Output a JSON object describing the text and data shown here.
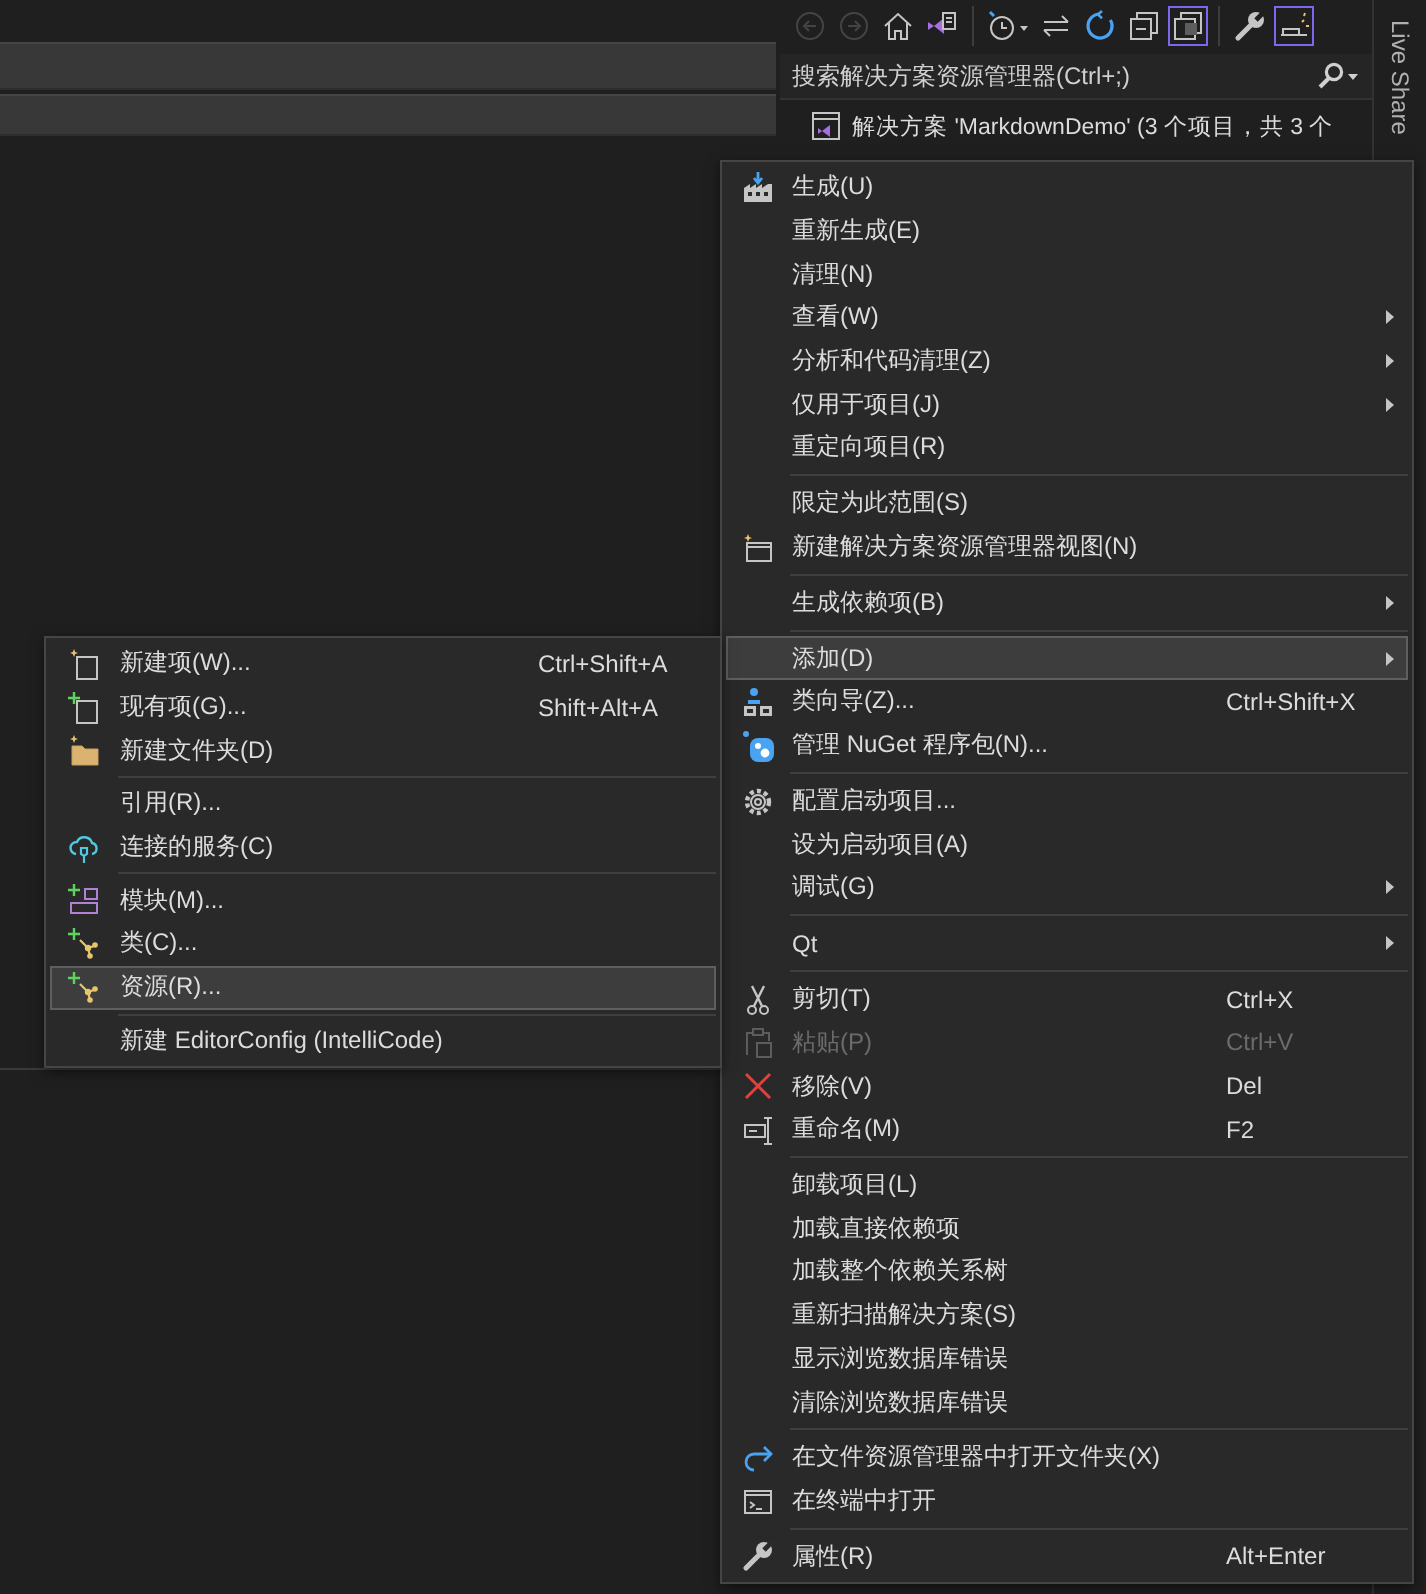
{
  "toolbar": {
    "buttons": [
      {
        "disabled": true,
        "on": false
      },
      {
        "disabled": true,
        "on": false
      },
      {
        "disabled": false,
        "on": false
      },
      {
        "disabled": false,
        "on": false
      },
      {
        "disabled": false,
        "on": false
      },
      {
        "disabled": false,
        "on": false
      },
      {
        "disabled": false,
        "on": false
      },
      {
        "disabled": false,
        "on": false
      },
      {
        "disabled": false,
        "on": true
      },
      {
        "disabled": false,
        "on": false
      },
      {
        "disabled": false,
        "on": true
      }
    ]
  },
  "search": {
    "placeholder": "搜索解决方案资源管理器(Ctrl+;)"
  },
  "tree": {
    "items": [
      {
        "label": "解决方案 'MarkdownDemo' (3 个项目，共 3 个"
      }
    ]
  },
  "side_tab": {
    "label": "Live Share"
  },
  "context_menu": {
    "items": [
      {
        "kind": "item",
        "label": "生成(U)",
        "submenu": false,
        "disabled": false,
        "selected": false
      },
      {
        "kind": "item",
        "label": "重新生成(E)",
        "submenu": false,
        "disabled": false,
        "selected": false
      },
      {
        "kind": "item",
        "label": "清理(N)",
        "submenu": false,
        "disabled": false,
        "selected": false
      },
      {
        "kind": "item",
        "label": "查看(W)",
        "submenu": true,
        "disabled": false,
        "selected": false
      },
      {
        "kind": "item",
        "label": "分析和代码清理(Z)",
        "submenu": true,
        "disabled": false,
        "selected": false
      },
      {
        "kind": "item",
        "label": "仅用于项目(J)",
        "submenu": true,
        "disabled": false,
        "selected": false
      },
      {
        "kind": "item",
        "label": "重定向项目(R)",
        "submenu": false,
        "disabled": false,
        "selected": false
      },
      {
        "kind": "separator"
      },
      {
        "kind": "item",
        "label": "限定为此范围(S)",
        "submenu": false,
        "disabled": false,
        "selected": false
      },
      {
        "kind": "item",
        "label": "新建解决方案资源管理器视图(N)",
        "submenu": false,
        "disabled": false,
        "selected": false
      },
      {
        "kind": "separator"
      },
      {
        "kind": "item",
        "label": "生成依赖项(B)",
        "submenu": true,
        "disabled": false,
        "selected": false
      },
      {
        "kind": "separator"
      },
      {
        "kind": "item",
        "label": "添加(D)",
        "submenu": true,
        "disabled": false,
        "selected": true
      },
      {
        "kind": "item",
        "label": "类向导(Z)...",
        "shortcut": "Ctrl+Shift+X",
        "submenu": false,
        "disabled": false,
        "selected": false
      },
      {
        "kind": "item",
        "label": "管理 NuGet 程序包(N)...",
        "submenu": false,
        "disabled": false,
        "selected": false
      },
      {
        "kind": "separator"
      },
      {
        "kind": "item",
        "label": "配置启动项目...",
        "submenu": false,
        "disabled": false,
        "selected": false
      },
      {
        "kind": "item",
        "label": "设为启动项目(A)",
        "submenu": false,
        "disabled": false,
        "selected": false
      },
      {
        "kind": "item",
        "label": "调试(G)",
        "submenu": true,
        "disabled": false,
        "selected": false
      },
      {
        "kind": "separator"
      },
      {
        "kind": "item",
        "label": "Qt",
        "submenu": true,
        "disabled": false,
        "selected": false
      },
      {
        "kind": "separator"
      },
      {
        "kind": "item",
        "label": "剪切(T)",
        "shortcut": "Ctrl+X",
        "submenu": false,
        "disabled": false,
        "selected": false
      },
      {
        "kind": "item",
        "label": "粘贴(P)",
        "shortcut": "Ctrl+V",
        "submenu": false,
        "disabled": true,
        "selected": false
      },
      {
        "kind": "item",
        "label": "移除(V)",
        "shortcut": "Del",
        "submenu": false,
        "disabled": false,
        "selected": false
      },
      {
        "kind": "item",
        "label": "重命名(M)",
        "shortcut": "F2",
        "submenu": false,
        "disabled": false,
        "selected": false
      },
      {
        "kind": "separator"
      },
      {
        "kind": "item",
        "label": "卸载项目(L)",
        "submenu": false,
        "disabled": false,
        "selected": false
      },
      {
        "kind": "item",
        "label": "加载直接依赖项",
        "submenu": false,
        "disabled": false,
        "selected": false
      },
      {
        "kind": "item",
        "label": "加载整个依赖关系树",
        "submenu": false,
        "disabled": false,
        "selected": false
      },
      {
        "kind": "item",
        "label": "重新扫描解决方案(S)",
        "submenu": false,
        "disabled": false,
        "selected": false
      },
      {
        "kind": "item",
        "label": "显示浏览数据库错误",
        "submenu": false,
        "disabled": false,
        "selected": false
      },
      {
        "kind": "item",
        "label": "清除浏览数据库错误",
        "submenu": false,
        "disabled": false,
        "selected": false
      },
      {
        "kind": "separator"
      },
      {
        "kind": "item",
        "label": "在文件资源管理器中打开文件夹(X)",
        "submenu": false,
        "disabled": false,
        "selected": false
      },
      {
        "kind": "item",
        "label": "在终端中打开",
        "submenu": false,
        "disabled": false,
        "selected": false
      },
      {
        "kind": "separator"
      },
      {
        "kind": "item",
        "label": "属性(R)",
        "shortcut": "Alt+Enter",
        "submenu": false,
        "disabled": false,
        "selected": false
      }
    ]
  },
  "submenu": {
    "items": [
      {
        "kind": "item",
        "label": "新建项(W)...",
        "shortcut": "Ctrl+Shift+A",
        "disabled": false,
        "selected": false
      },
      {
        "kind": "item",
        "label": "现有项(G)...",
        "shortcut": "Shift+Alt+A",
        "disabled": false,
        "selected": false
      },
      {
        "kind": "item",
        "label": "新建文件夹(D)",
        "disabled": false,
        "selected": false
      },
      {
        "kind": "separator"
      },
      {
        "kind": "item",
        "label": "引用(R)...",
        "disabled": false,
        "selected": false
      },
      {
        "kind": "item",
        "label": "连接的服务(C)",
        "disabled": false,
        "selected": false
      },
      {
        "kind": "separator"
      },
      {
        "kind": "item",
        "label": "模块(M)...",
        "disabled": false,
        "selected": false
      },
      {
        "kind": "item",
        "label": "类(C)...",
        "disabled": false,
        "selected": false
      },
      {
        "kind": "item",
        "label": "资源(R)...",
        "disabled": false,
        "selected": true
      },
      {
        "kind": "separator"
      },
      {
        "kind": "item",
        "label": "新建 EditorConfig (IntelliCode)",
        "disabled": false,
        "selected": false
      }
    ]
  }
}
